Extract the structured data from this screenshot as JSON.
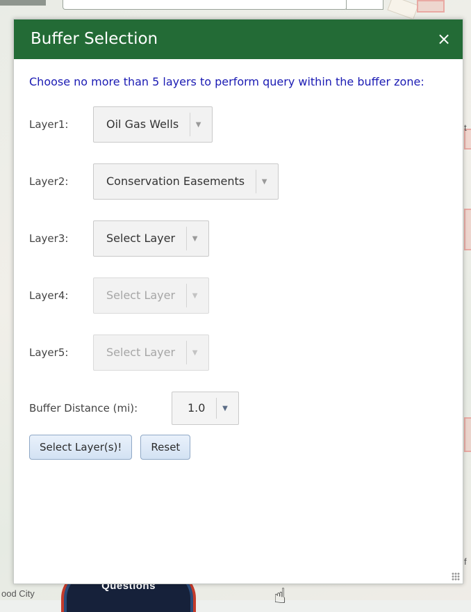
{
  "map": {
    "place_label": "ood City",
    "questions_button": "Questions",
    "right_edge_label": "t",
    "right_edge_label2": "f"
  },
  "dialog": {
    "title": "Buffer Selection",
    "close_icon": "×",
    "instruction": "Choose no more than 5 layers to perform query within the buffer zone:",
    "layers": [
      {
        "label": "Layer1:",
        "value": "Oil Gas Wells",
        "enabled": true
      },
      {
        "label": "Layer2:",
        "value": "Conservation Easements",
        "enabled": true
      },
      {
        "label": "Layer3:",
        "value": "Select Layer",
        "enabled": true
      },
      {
        "label": "Layer4:",
        "value": "Select Layer",
        "enabled": false
      },
      {
        "label": "Layer5:",
        "value": "Select Layer",
        "enabled": false
      }
    ],
    "buffer": {
      "label": "Buffer Distance (mi):",
      "value": "1.0"
    },
    "buttons": {
      "select": "Select Layer(s)!",
      "reset": "Reset"
    }
  },
  "colors": {
    "header_bg": "#236b36",
    "instruction_text": "#1a1ab3",
    "button_border": "#8fa8c6"
  },
  "icons": {
    "close": "close-icon",
    "dropdown": "chevron-down-icon",
    "cursor": "hand-pointer-icon"
  }
}
